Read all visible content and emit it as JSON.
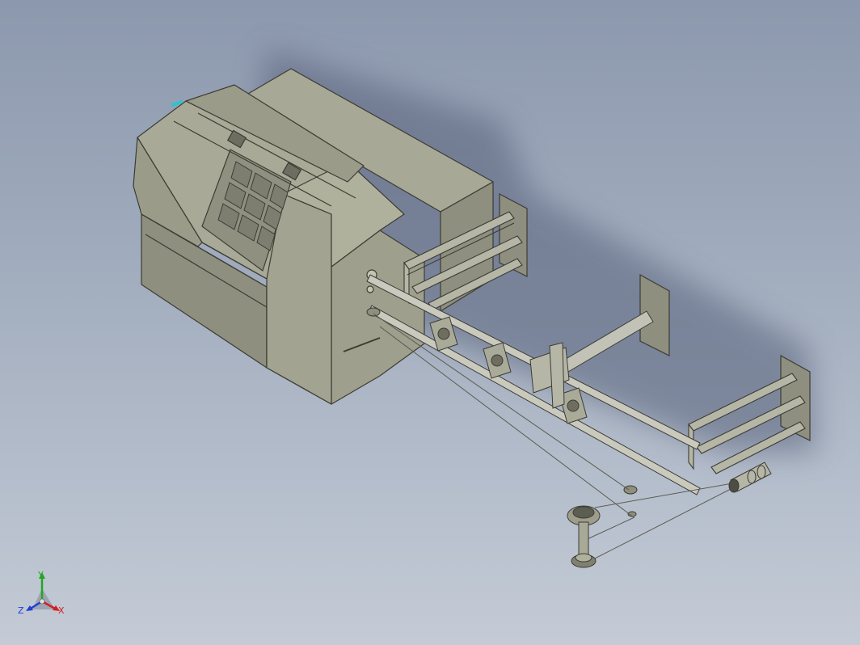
{
  "viewport": {
    "background_top": "#8c98ad",
    "background_bottom": "#c4cbd6"
  },
  "model": {
    "body_color": "#9c9d8b",
    "shade_color": "#7f806f",
    "dark_edge": "#3c3c34",
    "window_color": "#6e6f63",
    "accent_color": "#2ec4c9"
  },
  "triad": {
    "y_label": "Y",
    "z_label": "Z",
    "x_label": "X",
    "x_color": "#d42020",
    "y_color": "#22a822",
    "z_color": "#2040d4"
  }
}
